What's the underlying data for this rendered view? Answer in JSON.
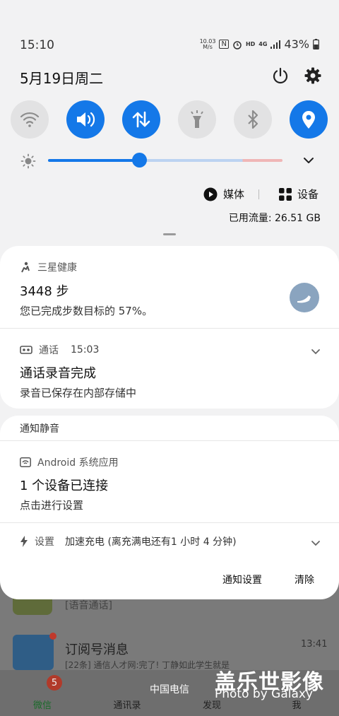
{
  "status": {
    "time": "15:10",
    "net_speed_value": "10.03",
    "net_speed_unit": "M/s",
    "nfc_icon": "N",
    "hd_label": "HD",
    "network_label": "4G",
    "battery": "43%"
  },
  "header": {
    "date": "5月19日周二"
  },
  "quick_tiles": [
    {
      "name": "wifi-tile",
      "icon": "wifi-icon",
      "state": "off"
    },
    {
      "name": "sound-tile",
      "icon": "speaker-icon",
      "state": "on"
    },
    {
      "name": "mobile-data-tile",
      "icon": "data-arrows-icon",
      "state": "on"
    },
    {
      "name": "flashlight-tile",
      "icon": "flashlight-icon",
      "state": "off"
    },
    {
      "name": "bluetooth-tile",
      "icon": "bluetooth-icon",
      "state": "off"
    },
    {
      "name": "location-tile",
      "icon": "location-icon",
      "state": "on"
    }
  ],
  "brightness": {
    "level": 0.39
  },
  "media": {
    "media_label": "媒体",
    "devices_label": "设备"
  },
  "data_usage": "已用流量: 26.51 GB",
  "notifications": {
    "health": {
      "app": "三星健康",
      "title": "3448 步",
      "body": "您已完成步数目标的 57%。"
    },
    "call": {
      "app": "通话",
      "time": "15:03",
      "title": "通话录音完成",
      "body": "录音已保存在内部存储中"
    },
    "silent_header": "通知静音",
    "android": {
      "app": "Android 系统应用",
      "title": "1 个设备已连接",
      "body": "点击进行设置"
    },
    "settings": {
      "app": "设置",
      "body": "加速充电 (离充满电还有1 小时 4 分钟)"
    },
    "actions": {
      "settings_label": "通知设置",
      "clear_label": "清除"
    }
  },
  "background": {
    "item1_text": "[语音通话]",
    "item2_title": "订阅号消息",
    "item2_time": "13:41",
    "item2_sub": "[22条] 通信人才网:完了! 丁静如此学生就是",
    "tabs": [
      "微信",
      "通讯录",
      "发现",
      "我"
    ],
    "badge": "5",
    "carrier": "中国电信"
  },
  "watermark": {
    "main": "盖乐世影像",
    "sub": "Photo by Galaxy"
  },
  "colors": {
    "accent": "#1478e8",
    "tile_off": "#e2e2e3",
    "panel": "#f2f2f3"
  }
}
